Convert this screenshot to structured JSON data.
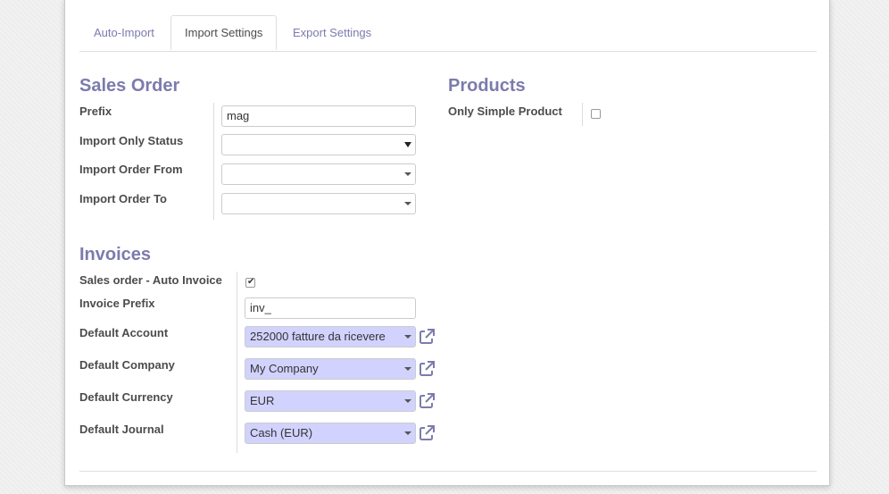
{
  "tabs": [
    {
      "label": "Auto-Import"
    },
    {
      "label": "Import Settings"
    },
    {
      "label": "Export Settings"
    }
  ],
  "sales_order": {
    "title": "Sales Order",
    "prefix_label": "Prefix",
    "prefix_value": "mag",
    "import_only_status_label": "Import Only Status",
    "import_only_status_value": "",
    "import_order_from_label": "Import Order From",
    "import_order_from_value": "",
    "import_order_to_label": "Import Order To",
    "import_order_to_value": ""
  },
  "products": {
    "title": "Products",
    "only_simple_product_label": "Only Simple Product",
    "only_simple_product_checked": false
  },
  "invoices": {
    "title": "Invoices",
    "auto_invoice_label": "Sales order - Auto Invoice",
    "auto_invoice_checked": true,
    "invoice_prefix_label": "Invoice Prefix",
    "invoice_prefix_value": "inv_",
    "default_account_label": "Default Account",
    "default_account_value": "252000 fatture da ricevere",
    "default_company_label": "Default Company",
    "default_company_value": "My Company",
    "default_currency_label": "Default Currency",
    "default_currency_value": "EUR",
    "default_journal_label": "Default Journal",
    "default_journal_value": "Cash (EUR)"
  },
  "icons": {
    "external_link": "external-link-icon",
    "checkbox_tick": "check-icon",
    "dropdown": "chevron-down-icon"
  },
  "colors": {
    "accent": "#7c7bad",
    "many2one_bg": "#d2d2ff"
  }
}
